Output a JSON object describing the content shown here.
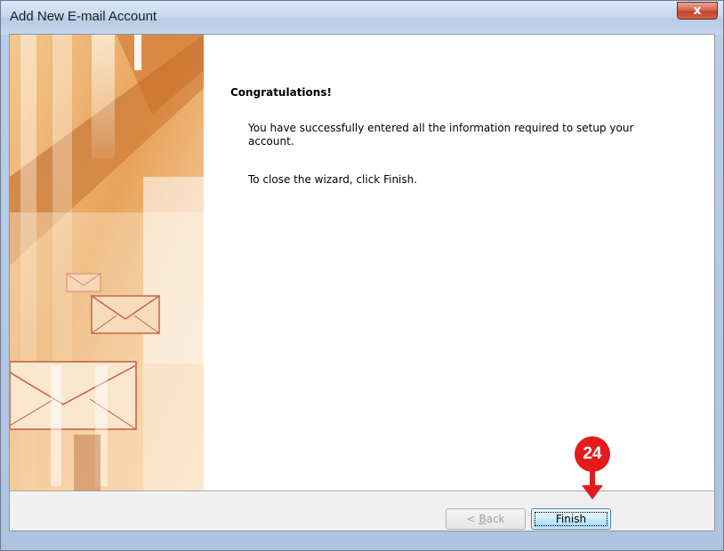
{
  "window": {
    "title": "Add New E-mail Account",
    "close_glyph": "x"
  },
  "content": {
    "heading": "Congratulations!",
    "paragraph1": "You have successfully entered all the information required to setup your account.",
    "paragraph2": "To close the wizard, click Finish."
  },
  "buttons": {
    "back_prefix": "< ",
    "back_accel": "B",
    "back_suffix": "ack",
    "finish": "Finish"
  },
  "annotation": {
    "step_number": "24"
  },
  "colors": {
    "callout": "#e51a1a",
    "finish_border": "#3c7fb1"
  },
  "icons": [
    "close-icon",
    "envelope-icon",
    "arrow-down-icon"
  ]
}
